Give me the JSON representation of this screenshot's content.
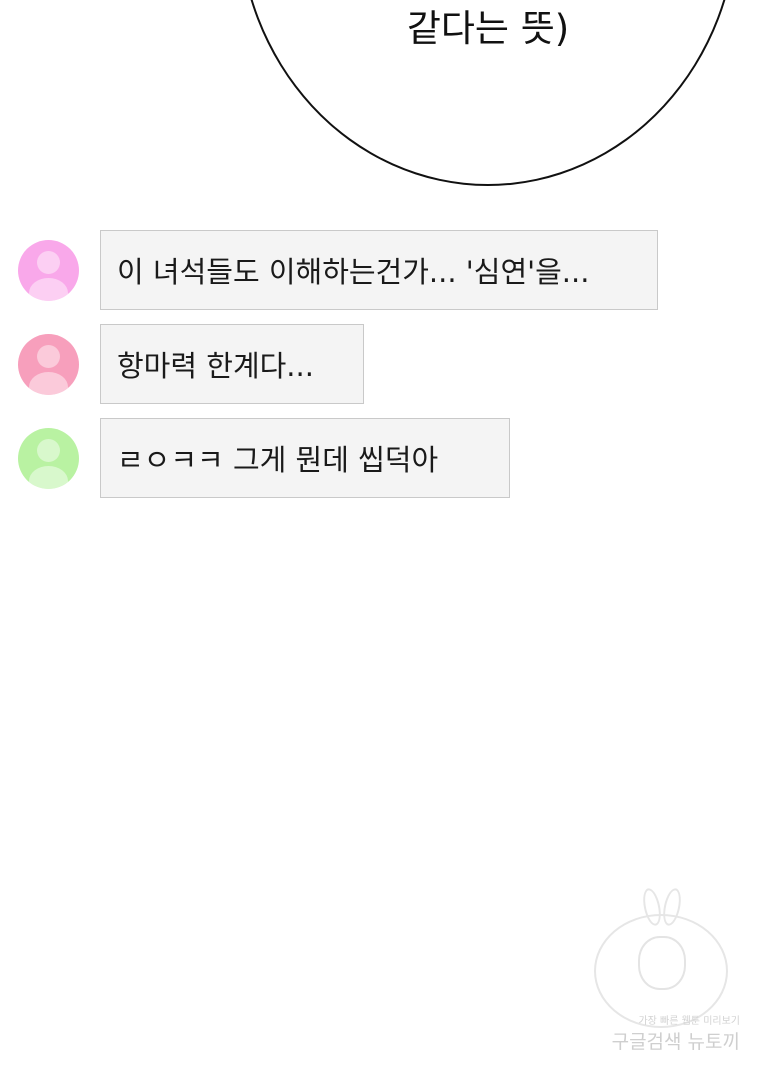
{
  "speech_bubble": {
    "text": "같다는 뜻)"
  },
  "comments": [
    {
      "text": "이 녀석들도 이해하는건가... '심연'을...",
      "avatar_color": "#f9a8ea"
    },
    {
      "text": "항마력 한계다...",
      "avatar_color": "#f79fbc"
    },
    {
      "text": "ㄹㅇㅋㅋ 그게 뭔데 씹덕아",
      "avatar_color": "#b9f2a2"
    }
  ],
  "watermark": {
    "subtitle": "가장 빠른 웹툰 미리보기",
    "title": "구글검색 뉴토끼"
  }
}
